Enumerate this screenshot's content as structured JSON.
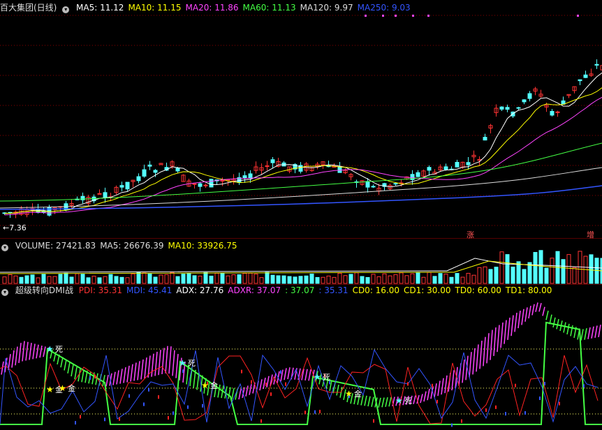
{
  "price_panel": {
    "title": "百大集团(日线)",
    "indicators": [
      {
        "label": "MA5: 11.12",
        "color": "#ffffff"
      },
      {
        "label": "MA10: 11.15",
        "color": "#ffff00"
      },
      {
        "label": "MA20: 11.86",
        "color": "#ff44ff"
      },
      {
        "label": "MA60: 11.13",
        "color": "#44ff44"
      },
      {
        "label": "MA120: 9.97",
        "color": "#dddddd"
      },
      {
        "label": "MA250: 9.03",
        "color": "#3355ff"
      }
    ],
    "low_label": "←7.36",
    "mark_zhang": "涨",
    "mark_zeng": "增"
  },
  "volume_panel": {
    "indicators": [
      {
        "label": "VOLUME: 27421.83",
        "color": "#dddddd"
      },
      {
        "label": "MA5: 26676.39",
        "color": "#dddddd"
      },
      {
        "label": "MA10: 33926.75",
        "color": "#ffff00"
      }
    ]
  },
  "dmi_panel": {
    "title": "超级转向DMI战",
    "indicators": [
      {
        "label": "PDI: 35.31",
        "color": "#ff3333"
      },
      {
        "label": "MDI: 45.41",
        "color": "#3355ff"
      },
      {
        "label": "ADX: 27.76",
        "color": "#ffffff"
      },
      {
        "label": "ADXR: 37.07",
        "color": "#ff44ff"
      },
      {
        "label": ": 37.07",
        "color": "#44ff44"
      },
      {
        "label": ": 35.31",
        "color": "#3355ff"
      },
      {
        "label": "CD0: 16.00",
        "color": "#ffff00"
      },
      {
        "label": "CD1: 30.00",
        "color": "#ffff00"
      },
      {
        "label": "TD0: 60.00",
        "color": "#ffff00"
      },
      {
        "label": "TD1: 80.00",
        "color": "#ffff00"
      }
    ],
    "signals": [
      {
        "text": "死"
      },
      {
        "text": "金"
      },
      {
        "text": "金"
      },
      {
        "text": "死"
      },
      {
        "text": "金"
      },
      {
        "text": "死"
      },
      {
        "text": "金"
      },
      {
        "text": "死"
      }
    ]
  },
  "colors": {
    "up": "#ff3333",
    "down": "#54ffff",
    "grid": "#8b0000"
  }
}
